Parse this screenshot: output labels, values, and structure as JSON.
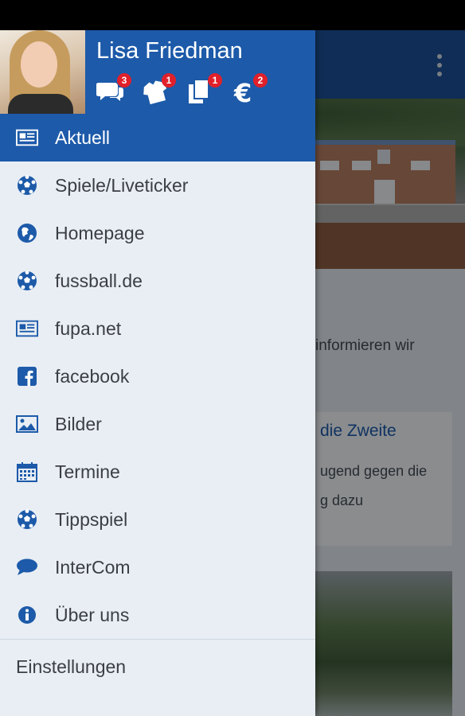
{
  "user": {
    "name": "Lisa Friedman"
  },
  "header_icons": [
    {
      "icon": "chat-bubbles-icon",
      "count": "3"
    },
    {
      "icon": "jersey-icon",
      "count": "1"
    },
    {
      "icon": "documents-icon",
      "count": "1"
    },
    {
      "icon": "euro-icon",
      "count": "2"
    }
  ],
  "menu": [
    {
      "label": "Aktuell",
      "icon": "newspaper-icon",
      "active": true
    },
    {
      "label": "Spiele/Liveticker",
      "icon": "soccer-ball-icon"
    },
    {
      "label": "Homepage",
      "icon": "globe-icon"
    },
    {
      "label": "fussball.de",
      "icon": "soccer-ball-icon"
    },
    {
      "label": "fupa.net",
      "icon": "newspaper-icon"
    },
    {
      "label": "facebook",
      "icon": "facebook-icon"
    },
    {
      "label": "Bilder",
      "icon": "image-icon"
    },
    {
      "label": "Termine",
      "icon": "calendar-icon"
    },
    {
      "label": "Tippspiel",
      "icon": "soccer-ball-icon"
    },
    {
      "label": "InterCom",
      "icon": "chat-icon"
    },
    {
      "label": "Über uns",
      "icon": "info-icon"
    }
  ],
  "settings_label": "Einstellungen",
  "background": {
    "text_line": "informieren wir",
    "card_title": "die Zweite",
    "card_line1": "ugend gegen die",
    "card_line2": "g dazu"
  },
  "colors": {
    "primary": "#1d5aa9",
    "drawer_bg": "#e8eef4",
    "badge": "#e0202a"
  }
}
